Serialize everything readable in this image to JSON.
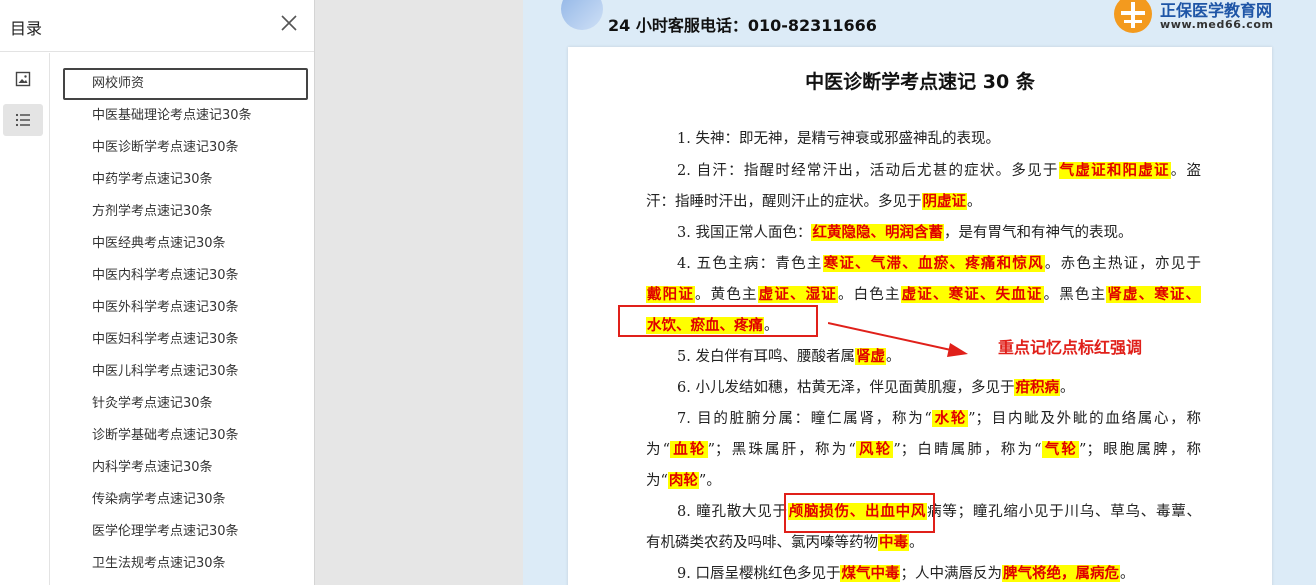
{
  "sidebar": {
    "title": "目录",
    "items": [
      "网校师资",
      "中医基础理论考点速记30条",
      "中医诊断学考点速记30条",
      "中药学考点速记30条",
      "方剂学考点速记30条",
      "中医经典考点速记30条",
      "中医内科学考点速记30条",
      "中医外科学考点速记30条",
      "中医妇科学考点速记30条",
      "中医儿科学考点速记30条",
      "针灸学考点速记30条",
      "诊断学基础考点速记30条",
      "内科学考点速记30条",
      "传染病学考点速记30条",
      "医学伦理学考点速记30条",
      "卫生法规考点速记30条"
    ]
  },
  "header": {
    "hotline": "24 小时客服电话：010-82311666",
    "brand_name": "正保医学教育网",
    "brand_url": "www.med66.com"
  },
  "document": {
    "title": "中医诊断学考点速记 30 条",
    "annotation": "重点记忆点标红强调",
    "lines": {
      "l1": [
        "1. 失神：即无神，是精亏神衰或邪盛神乱的表现。"
      ],
      "l2": [
        "2. 自汗：指醒时经常汗出，活动后尤甚的症状。多见于",
        "气虚证和阳虚证",
        "。盗"
      ],
      "l3": [
        "汗：指睡时汗出，醒则汗止的症状。多见于",
        "阴虚证",
        "。"
      ],
      "l4": [
        "3. 我国正常人面色：",
        "红黄隐隐、明润含蓄",
        "，是有胃气和有神气的表现。"
      ],
      "l5": [
        "4. 五色主病：青色主",
        "寒证、气滞、血瘀、疼痛和惊风",
        "。赤色主热证，亦见于"
      ],
      "l6": [
        "",
        "戴阳证",
        "。黄色主",
        "虚证、湿证",
        "。白色主",
        "虚证、寒证、失血证",
        "。黑色主",
        "肾虚、寒证、"
      ],
      "l7": [
        "",
        "水饮、瘀血、疼痛",
        "。"
      ],
      "l8": [
        "5. 发白伴有耳鸣、腰酸者属",
        "肾虚",
        "。"
      ],
      "l9": [
        "6. 小儿发结如穗，枯黄无泽，伴见面黄肌瘦，多见于",
        "疳积病",
        "。"
      ],
      "l10": [
        "7. 目的脏腑分属：瞳仁属肾，称为“",
        "水轮",
        "”；目内眦及外眦的血络属心，称"
      ],
      "l11": [
        "为“",
        "血轮",
        "”；黑珠属肝，称为“",
        "风轮",
        "”；白睛属肺，称为“",
        "气轮",
        "”；眼胞属脾，称"
      ],
      "l12": [
        "为“",
        "肉轮",
        "”。"
      ],
      "l13": [
        "8. 瞳孔散大见于",
        "颅脑损伤、出血中风",
        "病等；瞳孔缩小见于川乌、草乌、毒蕈、"
      ],
      "l14": [
        "有机磷类农药及吗啡、氯丙嗪等药物",
        "中毒",
        "。"
      ],
      "l15": [
        "9. 口唇呈樱桃红色多见于",
        "煤气中毒",
        "；人中满唇反为",
        "脾气将绝，属病危",
        "。"
      ]
    }
  },
  "colors": {
    "highlight_bg": "#ffff00",
    "highlight_text": "#e00000",
    "annotation_red": "#e0201a",
    "doc_bg": "#dcebf7",
    "brand_blue": "#1e55a6",
    "logo_orange": "#f39a1e"
  },
  "icons": {
    "close": "close-icon",
    "thumbnail": "image-icon",
    "toc": "list-icon",
    "arrow": "arrow-icon"
  }
}
